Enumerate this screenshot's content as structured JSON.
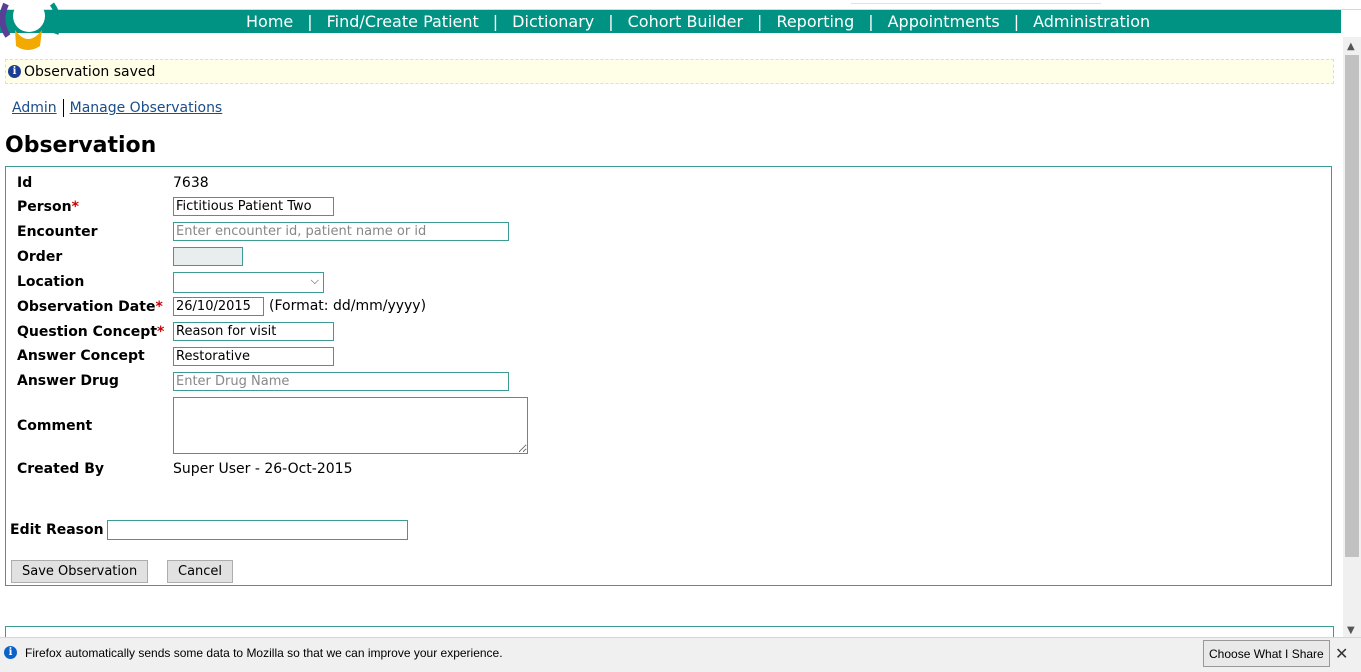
{
  "nav": {
    "items": [
      "Home",
      "Find/Create Patient",
      "Dictionary",
      "Cohort Builder",
      "Reporting",
      "Appointments",
      "Administration"
    ]
  },
  "flash": {
    "message": "Observation saved"
  },
  "breadcrumb": {
    "admin": "Admin",
    "manage": "Manage Observations"
  },
  "page": {
    "title": "Observation"
  },
  "form": {
    "id_label": "Id",
    "id_value": "7638",
    "person_label": "Person",
    "person_value": "Fictitious Patient Two",
    "encounter_label": "Encounter",
    "encounter_placeholder": "Enter encounter id, patient name or id",
    "order_label": "Order",
    "location_label": "Location",
    "obs_date_label": "Observation Date",
    "obs_date_value": "26/10/2015",
    "obs_date_hint": "(Format: dd/mm/yyyy)",
    "question_label": "Question Concept",
    "question_value": "Reason for visit",
    "answer_label": "Answer Concept",
    "answer_value": "Restorative",
    "drug_label": "Answer Drug",
    "drug_placeholder": "Enter Drug Name",
    "comment_label": "Comment",
    "created_label": "Created By",
    "created_value": "Super User - 26-Oct-2015",
    "edit_reason_label": "Edit Reason",
    "required_mark": "*",
    "save_button": "Save Observation",
    "cancel_button": "Cancel"
  },
  "footer": {
    "message": "Firefox automatically sends some data to Mozilla so that we can improve your experience.",
    "choose_button": "Choose What I Share",
    "close_glyph": "✕",
    "info_icon_glyph": "i"
  },
  "colors": {
    "nav_bg": "#009384",
    "border": "#3c9b95",
    "link": "#1a4d8a",
    "required": "#cc0000",
    "flash_bg": "#fffee6"
  }
}
